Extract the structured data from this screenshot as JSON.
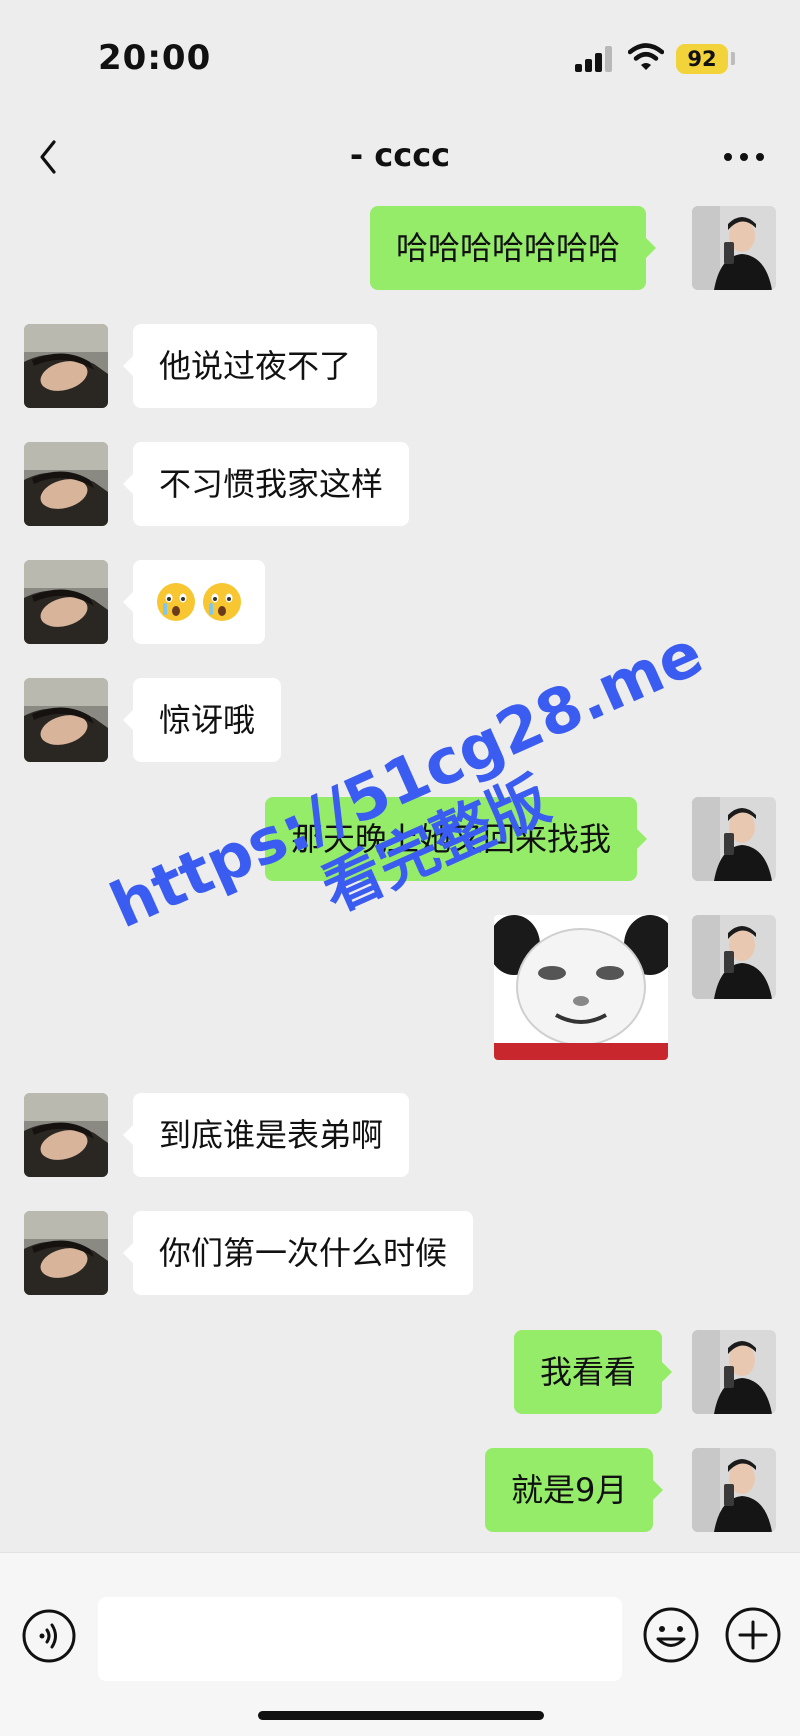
{
  "status_bar": {
    "time": "20:00",
    "battery": "92"
  },
  "header": {
    "title": "- cccc"
  },
  "messages": [
    {
      "from": "me",
      "type": "text",
      "text": "哈哈哈哈哈哈哈"
    },
    {
      "from": "other",
      "type": "text",
      "text": "他说过夜不了"
    },
    {
      "from": "other",
      "type": "text",
      "text": "不习惯我家这样"
    },
    {
      "from": "other",
      "type": "emoji",
      "emojis": [
        "😲",
        "😲"
      ]
    },
    {
      "from": "other",
      "type": "text",
      "text": "惊讶哦"
    },
    {
      "from": "me",
      "type": "text",
      "text": "那天晚上她又回来找我"
    },
    {
      "from": "me",
      "type": "sticker",
      "sticker": "panda-face-sticker"
    },
    {
      "from": "other",
      "type": "text",
      "text": "到底谁是表弟啊"
    },
    {
      "from": "other",
      "type": "text",
      "text": "你们第一次什么时候"
    },
    {
      "from": "me",
      "type": "text",
      "text": "我看看"
    },
    {
      "from": "me",
      "type": "text",
      "text": "就是9月"
    }
  ],
  "watermark": {
    "url": "https://51cg28.me",
    "text": "看完整版"
  },
  "input_bar": {
    "value": "",
    "icons": [
      "voice-icon",
      "emoji-icon",
      "plus-icon"
    ]
  },
  "colors": {
    "background": "#ededed",
    "bubble_out": "#95ec69",
    "bubble_in": "#ffffff",
    "watermark": "#3b5cf0",
    "battery": "#f2d33a"
  }
}
